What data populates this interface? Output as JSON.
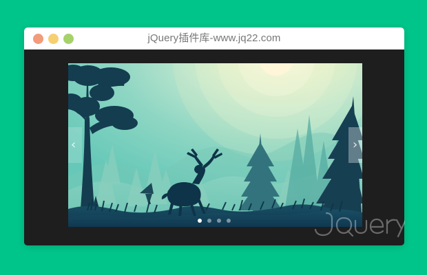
{
  "window": {
    "title": "jQuery插件库-www.jq22.com",
    "controls": [
      {
        "name": "close-button",
        "color": "#f39b7a"
      },
      {
        "name": "minimize-button",
        "color": "#f7cf71"
      },
      {
        "name": "maximize-button",
        "color": "#a6d26a"
      }
    ]
  },
  "slider": {
    "prev_label": "‹",
    "next_label": "›",
    "current_slide": 1,
    "slide_count": 4,
    "dots": [
      "",
      "",
      "",
      ""
    ]
  },
  "watermark": {
    "text": "jQuery插件库"
  },
  "colors": {
    "page_background": "#00c58a",
    "window_background": "#1e1e1e",
    "titlebar_background": "#ffffff",
    "title_text": "#777777"
  }
}
